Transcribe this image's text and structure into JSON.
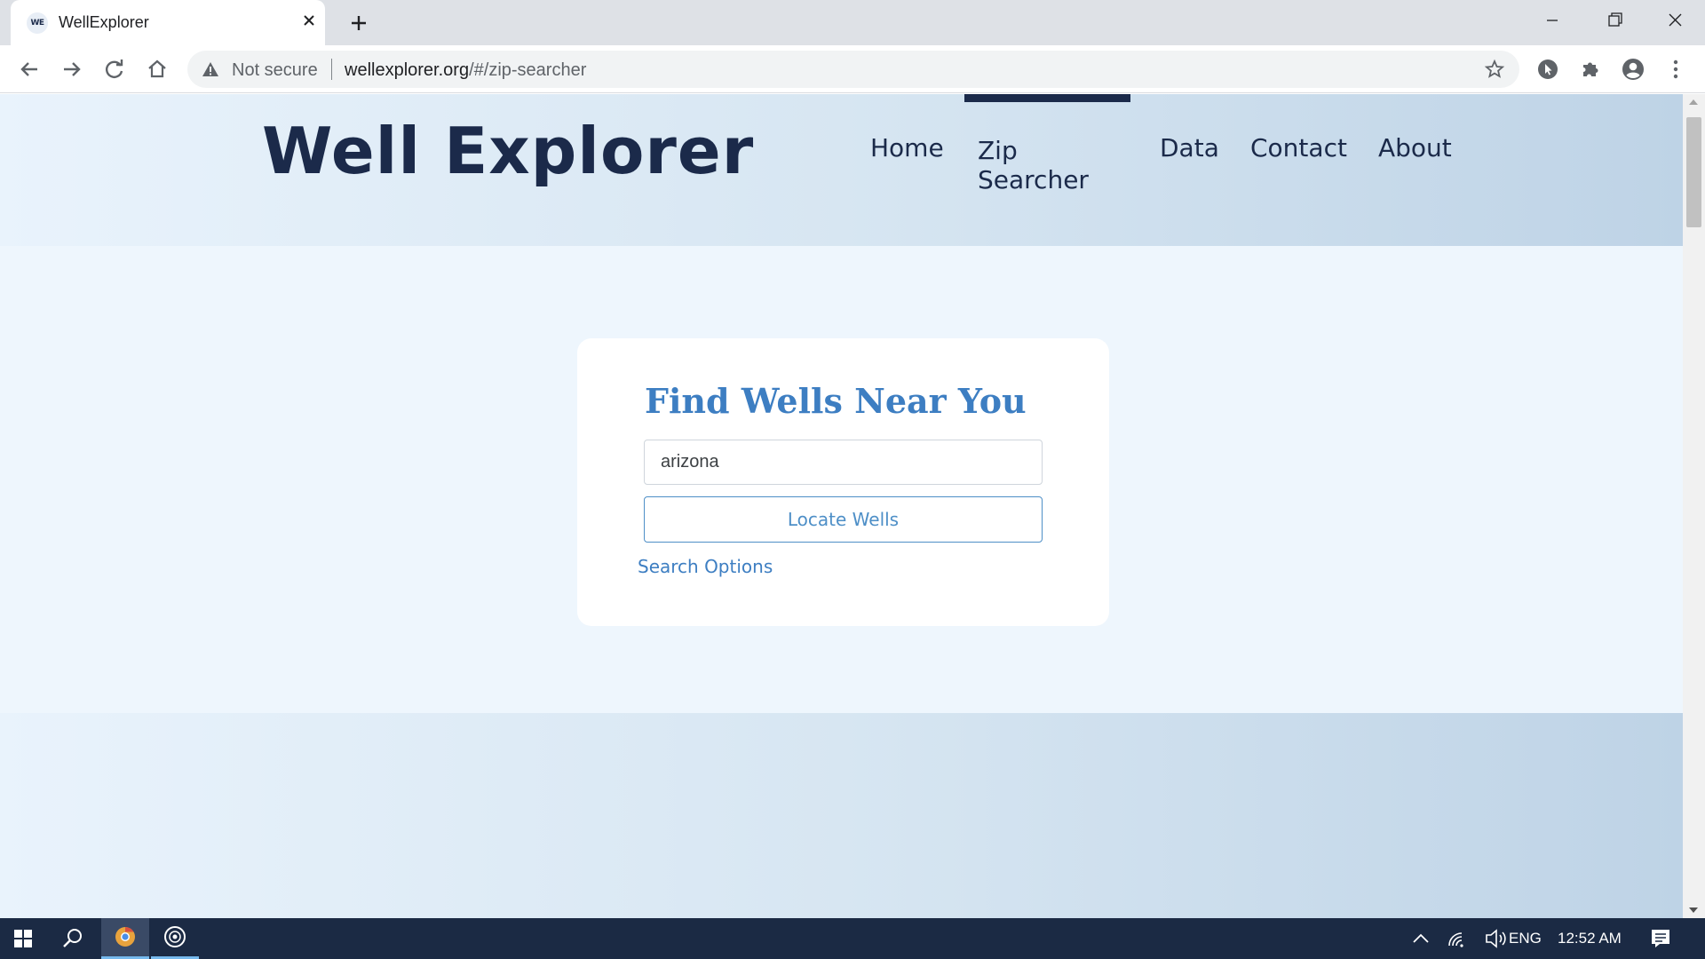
{
  "browser": {
    "tab": {
      "title": "WellExplorer",
      "favicon_text": "WE"
    },
    "address": {
      "security_label": "Not secure",
      "host": "wellexplorer.org",
      "path": "/#/zip-searcher"
    }
  },
  "site": {
    "logo": "Well Explorer",
    "nav": [
      {
        "label": "Home"
      },
      {
        "label": "Zip Searcher",
        "active": true
      },
      {
        "label": "Data"
      },
      {
        "label": "Contact"
      },
      {
        "label": "About"
      }
    ]
  },
  "search_card": {
    "title": "Find Wells Near You",
    "input_value": "arizona",
    "button_label": "Locate Wells",
    "options_link": "Search Options"
  },
  "taskbar": {
    "language": "ENG",
    "time": "12:52 AM"
  },
  "colors": {
    "brand_navy": "#1b2a4a",
    "accent_blue": "#3d7ec2",
    "taskbar": "#1b2a44"
  }
}
